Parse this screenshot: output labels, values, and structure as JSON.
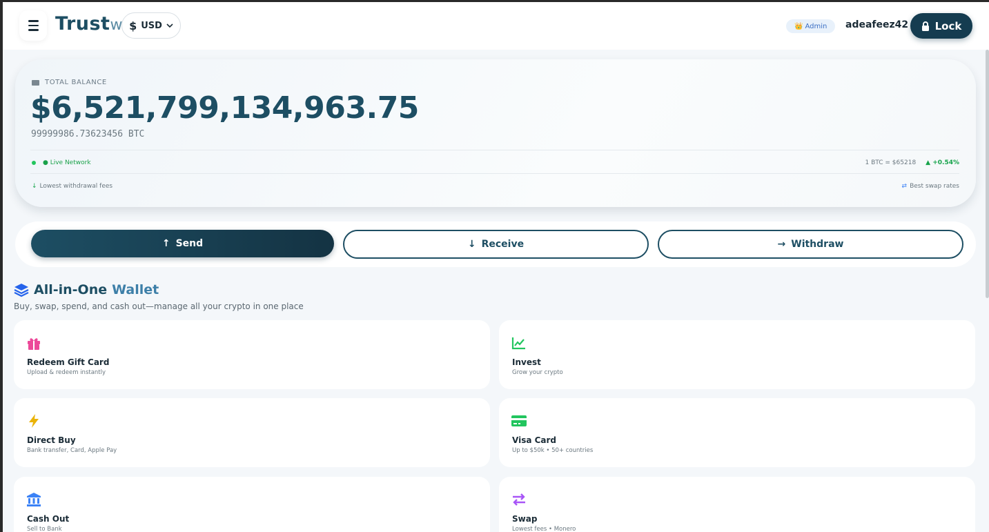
{
  "header": {
    "brand": "Trust",
    "brand_suffix": "w",
    "currency": "USD",
    "admin_badge": "Admin",
    "username": "adeafeez42",
    "lock_label": "Lock"
  },
  "balance": {
    "label": "TOTAL BALANCE",
    "amount": "$6,521,799,134,963.75",
    "btc": "99999986.73623456 BTC",
    "network": "● Live Network",
    "rate": "1 BTC = $65218",
    "change": "▲ +0.54%",
    "fees_note": "Lowest withdrawal fees",
    "swap_note": "Best swap rates"
  },
  "actions": {
    "send": "Send",
    "receive": "Receive",
    "withdraw": "Withdraw"
  },
  "section": {
    "title": "All-in-One",
    "title_accent": "Wallet",
    "subtitle": "Buy, swap, spend, and cash out—manage all your crypto in one place"
  },
  "tiles": [
    {
      "name": "Redeem Gift Card",
      "desc": "Upload & redeem instantly",
      "icon": "gift-icon",
      "color": "#ec4899"
    },
    {
      "name": "Invest",
      "desc": "Grow your crypto",
      "icon": "chart-line-icon",
      "color": "#22c55e"
    },
    {
      "name": "Direct Buy",
      "desc": "Bank transfer, Card, Apple Pay",
      "icon": "bolt-icon",
      "color": "#eab308"
    },
    {
      "name": "Visa Card",
      "desc": "Up to $50k • 50+ countries",
      "icon": "credit-card-icon",
      "color": "#22c55e"
    },
    {
      "name": "Cash Out",
      "desc": "Sell to Bank",
      "icon": "bank-icon",
      "color": "#3b82f6"
    },
    {
      "name": "Swap",
      "desc": "Lowest fees • Monero",
      "icon": "swap-arrows-icon",
      "color": "#a855f7"
    }
  ]
}
